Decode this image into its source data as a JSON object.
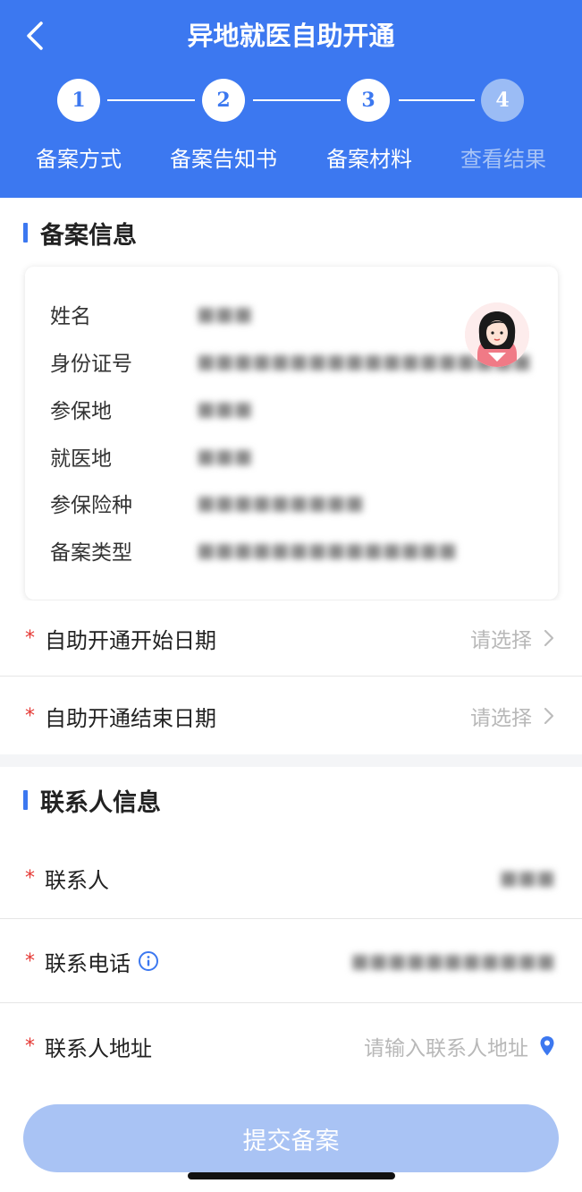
{
  "header": {
    "title": "异地就医自助开通",
    "back_icon": "chevron-left-icon"
  },
  "steps": [
    {
      "number": "1",
      "label": "备案方式",
      "state": "done"
    },
    {
      "number": "2",
      "label": "备案告知书",
      "state": "done"
    },
    {
      "number": "3",
      "label": "备案材料",
      "state": "current"
    },
    {
      "number": "4",
      "label": "查看结果",
      "state": "pending"
    }
  ],
  "filing_info": {
    "section_title": "备案信息",
    "avatar_icon": "female-avatar-icon",
    "rows": [
      {
        "label": "姓名",
        "value": "■■■"
      },
      {
        "label": "身份证号",
        "value": "■■■■■■■■■■■■■■■■■■"
      },
      {
        "label": "参保地",
        "value": "■■■"
      },
      {
        "label": "就医地",
        "value": "■■■"
      },
      {
        "label": "参保险种",
        "value": "■■■■■■■■■"
      },
      {
        "label": "备案类型",
        "value": "■■■■■■■■■■■■■■"
      }
    ]
  },
  "dates": {
    "start": {
      "label": "自助开通开始日期",
      "placeholder": "请选择"
    },
    "end": {
      "label": "自助开通结束日期",
      "placeholder": "请选择"
    }
  },
  "contact": {
    "section_title": "联系人信息",
    "name": {
      "label": "联系人",
      "value": "■■■"
    },
    "phone": {
      "label": "联系电话",
      "value": "■■■■■■■■■■■",
      "icon": "info-circle-icon"
    },
    "address": {
      "label": "联系人地址",
      "placeholder": "请输入联系人地址",
      "icon": "location-pin-icon"
    }
  },
  "required_mark": "*",
  "submit": {
    "label": "提交备案"
  },
  "colors": {
    "primary": "#3c78f0",
    "required": "#e53935",
    "button_disabled": "#a9c3f4"
  }
}
